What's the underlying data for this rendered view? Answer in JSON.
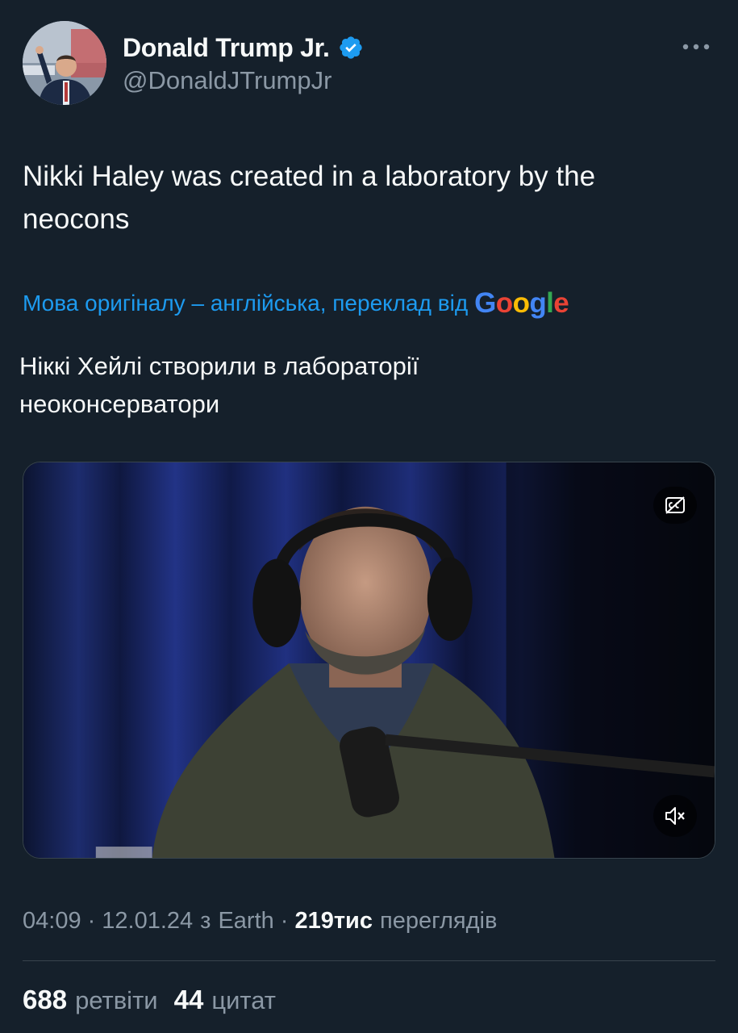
{
  "author": {
    "display_name": "Donald Trump Jr.",
    "handle": "@DonaldJTrumpJr",
    "verified": true,
    "verified_color": "#1d9bf0"
  },
  "more_icon": "more-horizontal-icon",
  "tweet": {
    "text_line1": "Nikki Haley was created in a laboratory by the",
    "text_line2": "neocons"
  },
  "translation": {
    "notice": "Мова оригіналу – англійська, переклад від",
    "provider_letters": [
      "G",
      "o",
      "o",
      "g",
      "l",
      "e"
    ],
    "provider_colors": [
      "#4285f4",
      "#ea4335",
      "#fbbc05",
      "#4285f4",
      "#34a853",
      "#ea4335"
    ],
    "text_line1": "Ніккі Хейлі створили в лабораторії",
    "text_line2": "неоконсерватори"
  },
  "video": {
    "captions_icon": "captions-off-icon",
    "mute_icon": "volume-muted-icon"
  },
  "meta": {
    "time": "04:09",
    "date": "12.01.24",
    "source_prefix": "з",
    "source": "Earth",
    "views_count": "219тис",
    "views_label": "переглядів"
  },
  "stats": {
    "retweets_count": "688",
    "retweets_label": "ретвіти",
    "quotes_count": "44",
    "quotes_label": "цитат"
  },
  "colors": {
    "background": "#15202b",
    "text_primary": "#f7f9f9",
    "text_secondary": "#8b98a5",
    "link": "#1d9bf0",
    "border": "#38444d"
  }
}
